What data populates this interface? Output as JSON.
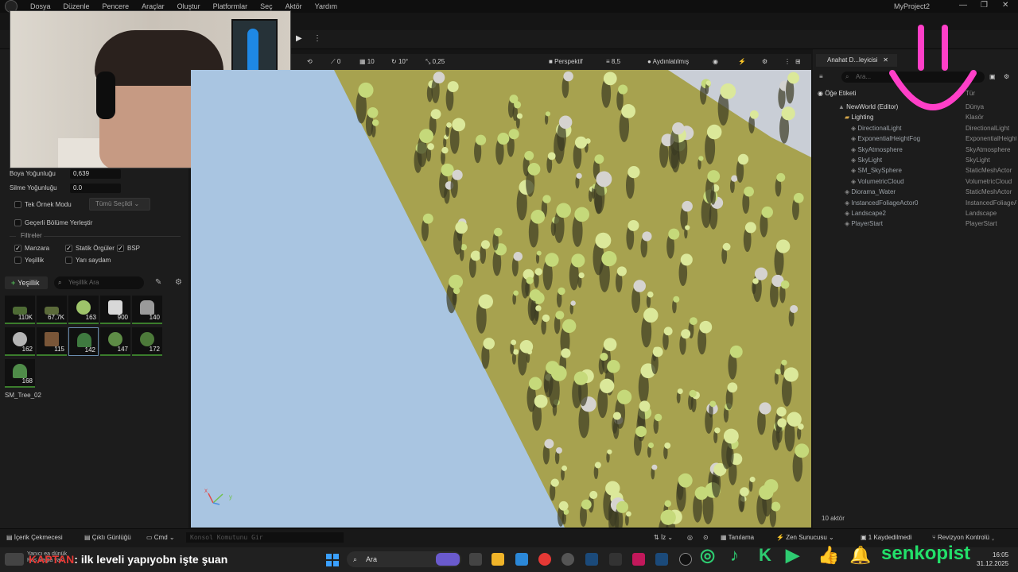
{
  "menubar": {
    "items": [
      "Dosya",
      "Düzenle",
      "Pencere",
      "Araçlar",
      "Oluştur",
      "Platformlar",
      "Seç",
      "Aktör",
      "Yardım"
    ],
    "project": "MyProject2",
    "minimize": "—",
    "maximize": "❐",
    "close": "✕"
  },
  "toolbar": {
    "play": "▶",
    "more": "⋮"
  },
  "viewport": {
    "transform_icon": "⟲",
    "rotate_label": "0",
    "grid_snap": "10",
    "angle_snap": "10°",
    "scale_snap": "0,25",
    "view_mode": "Perspektif",
    "camera_speed": "8,5",
    "lighting": "Aydınlatılmış",
    "axis_x": "x",
    "axis_y": "y"
  },
  "foliage": {
    "paint_density_label": "Boya Yoğunluğu",
    "paint_density_value": "0,639",
    "erase_density_label": "Silme Yoğunluğu",
    "erase_density_value": "0.0",
    "single_instance_label": "Tek Örnek Modu",
    "single_instance_dropdown": "Tümü Seçildi",
    "place_current_label": "Geçerli Bölüme Yerleştir",
    "filters_label": "Filtreler",
    "filters": [
      {
        "label": "Manzara",
        "checked": true
      },
      {
        "label": "Statik Örgüler",
        "checked": true
      },
      {
        "label": "BSP",
        "checked": true
      },
      {
        "label": "Yeşillik",
        "checked": false
      },
      {
        "label": "Yarı saydam",
        "checked": false
      }
    ],
    "add_button": "Yeşillik",
    "search_placeholder": "Yeşillik Ara",
    "tiles": [
      "110K",
      "67,7K",
      "163",
      "900",
      "140",
      "162",
      "115",
      "142",
      "147",
      "172",
      "168"
    ],
    "selected_tile_name": "SM_Tree_02"
  },
  "outliner": {
    "tab": "Anahat D...leyicisi",
    "search_placeholder": "Ara...",
    "column_label": "Öğe Etiketi",
    "column_type": "Tür",
    "rows": [
      {
        "label": "NewWorld (Editor)",
        "type": "Dünya"
      },
      {
        "label": "Lighting",
        "type": "Klasör"
      },
      {
        "label": "DirectionalLight",
        "type": "DirectionalLight"
      },
      {
        "label": "ExponentialHeightFog",
        "type": "ExponentialHeightFog"
      },
      {
        "label": "SkyAtmosphere",
        "type": "SkyAtmosphere"
      },
      {
        "label": "SkyLight",
        "type": "SkyLight"
      },
      {
        "label": "SM_SkySphere",
        "type": "StaticMeshActor"
      },
      {
        "label": "VolumetricCloud",
        "type": "VolumetricCloud"
      },
      {
        "label": "Diorama_Water",
        "type": "StaticMeshActor"
      },
      {
        "label": "InstancedFoliageActor0",
        "type": "InstancedFoliageActor"
      },
      {
        "label": "Landscape2",
        "type": "Landscape"
      },
      {
        "label": "PlayerStart",
        "type": "PlayerStart"
      }
    ],
    "count": "10 aktör"
  },
  "statusbar": {
    "content_drawer": "İçerik Çekmecesi",
    "output_log": "Çıktı Günlüğü",
    "cmd": "Cmd",
    "console_placeholder": "Konsol Komutunu Gir",
    "trace": "İz",
    "derive": "Tanılama",
    "zen": "Zen Sunucusu",
    "saved": "1 Kaydedilmedi",
    "revision": "Revizyon Kontrolü"
  },
  "taskbar": {
    "chat_top": "Yanıcı ea dünük",
    "chat_bottom": "Ras Sağla yak",
    "chat_user": "KAPTAN",
    "chat_message": ": ilk leveli yapıyobn işte şuan",
    "search": "Ara",
    "brand": "senkopist",
    "time": "16:05",
    "date": "31.12.2025"
  }
}
